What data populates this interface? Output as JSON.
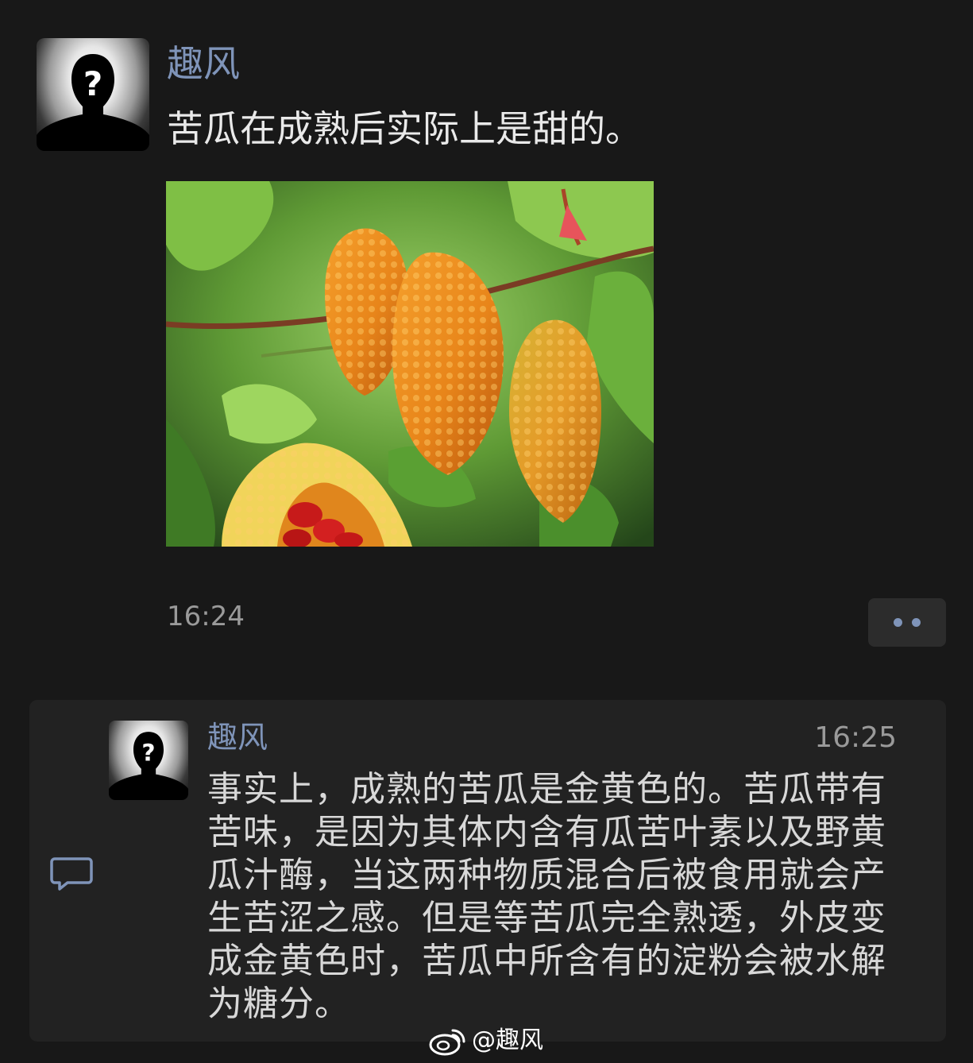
{
  "post": {
    "author": "趣风",
    "text": "苦瓜在成熟后实际上是甜的。",
    "time": "16:24",
    "image_icon": "ripe-bitter-melon-photo",
    "more_icon": "more-dots-icon"
  },
  "comment": {
    "author": "趣风",
    "time": "16:25",
    "text": "事实上，成熟的苦瓜是金黄色的。苦瓜带有苦味，是因为其体内含有瓜苦叶素以及野黄瓜汁酶，当这两种物质混合后被食用就会产生苦涩之感。但是等苦瓜完全熟透，外皮变成金黄色时，苦瓜中所含有的淀粉会被水解为糖分。",
    "icon": "comment-icon"
  },
  "watermark": {
    "text": "@趣风",
    "logo": "weibo-logo"
  },
  "colors": {
    "background": "#181818",
    "panel": "#222222",
    "author_name": "#7f94b9",
    "text": "#e9e9e9",
    "time": "#9a9a9a"
  }
}
